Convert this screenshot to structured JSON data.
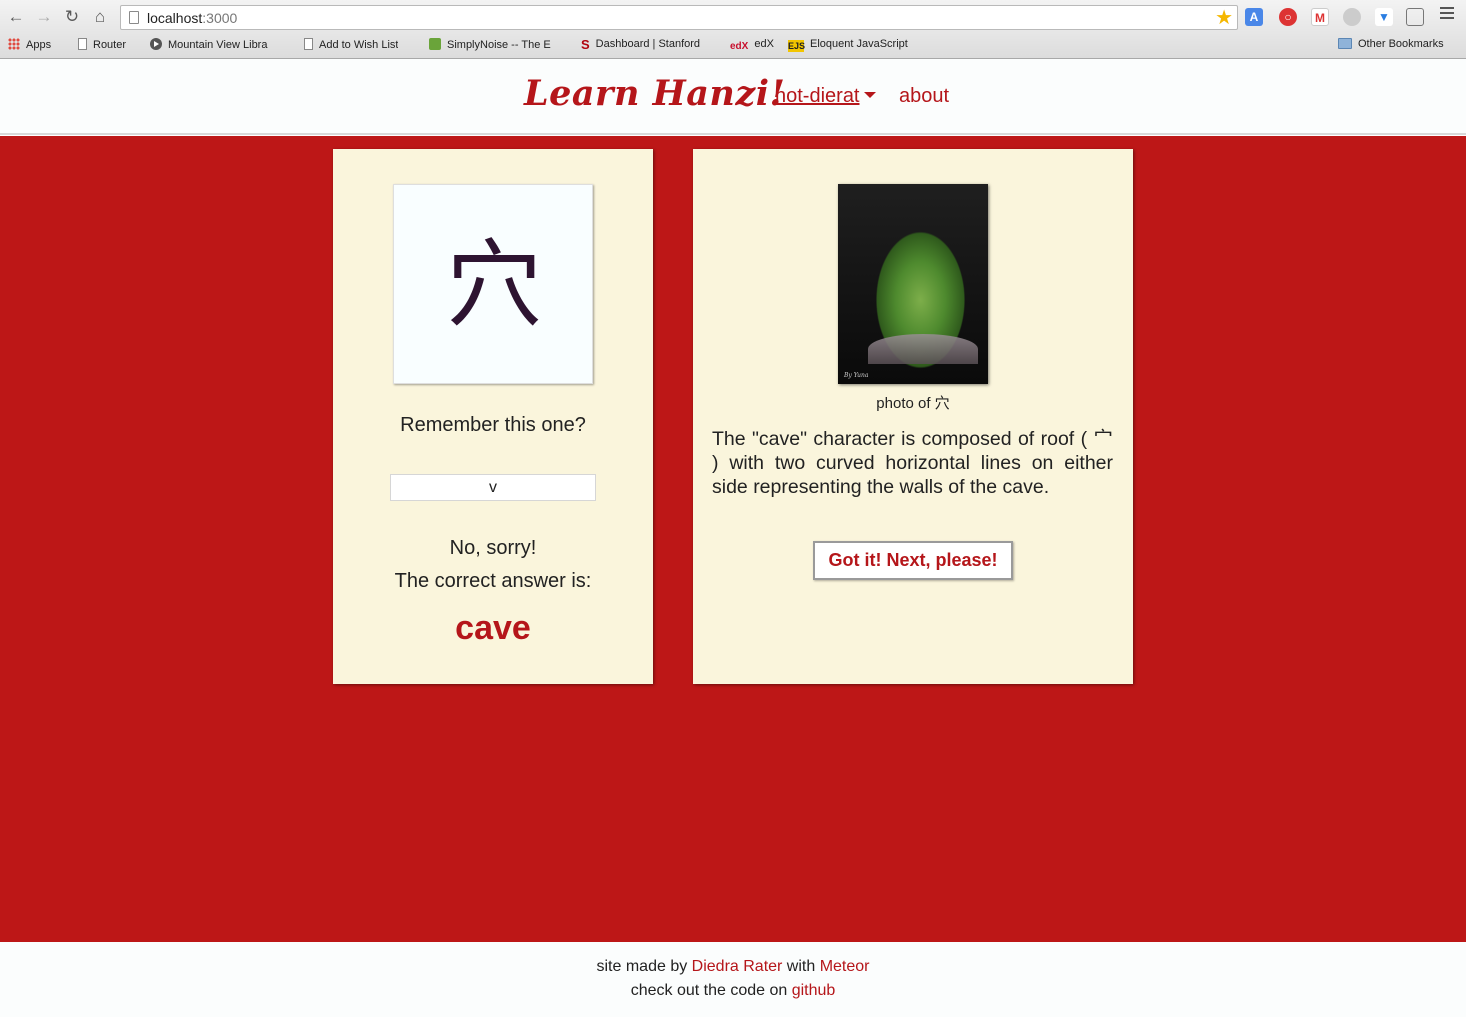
{
  "browser": {
    "url_host": "localhost",
    "url_port": ":3000",
    "bookmarks": [
      {
        "label": "Apps",
        "icon": "apps-grid-icon"
      },
      {
        "label": "Router",
        "icon": "page-icon"
      },
      {
        "label": "Mountain View Libra",
        "icon": "play-icon"
      },
      {
        "label": "Add to Wish List",
        "icon": "page-icon"
      },
      {
        "label": "SimplyNoise -- The E",
        "icon": "simplynoise-icon"
      },
      {
        "label": "Dashboard | Stanford",
        "icon": "stanford-icon"
      },
      {
        "label": "edX",
        "icon": "edx-icon"
      },
      {
        "label": "Eloquent JavaScript",
        "icon": "ejs-icon"
      }
    ],
    "other_bookmarks": "Other Bookmarks",
    "stanford_glyph": "S",
    "edx_glyph": "edX",
    "ejs_glyph": "EJS"
  },
  "header": {
    "brand": "Learn Hanzi!",
    "user": "not-dierat",
    "about": "about"
  },
  "quiz": {
    "character": "穴",
    "prompt": "Remember this one?",
    "input_value": "v",
    "result_no": "No, sorry!",
    "result_correct_label": "The correct answer is:",
    "correct_answer": "cave"
  },
  "explanation": {
    "photo_caption": "photo of 穴",
    "photo_signature": "By Yuna",
    "description": "The \"cave\" character is composed of roof ( 宀 ) with two curved horizontal lines on either side representing the walls of the cave.",
    "next_button": "Got it! Next, please!"
  },
  "footer": {
    "line1_prefix": "site made by ",
    "author": "Diedra Rater",
    "line1_mid": " with ",
    "framework": "Meteor",
    "line2_prefix": "check out the code on ",
    "repo": "github"
  },
  "colors": {
    "brand_red": "#bd1717",
    "card_bg": "#faf5dc",
    "link_red": "#b5161a"
  }
}
